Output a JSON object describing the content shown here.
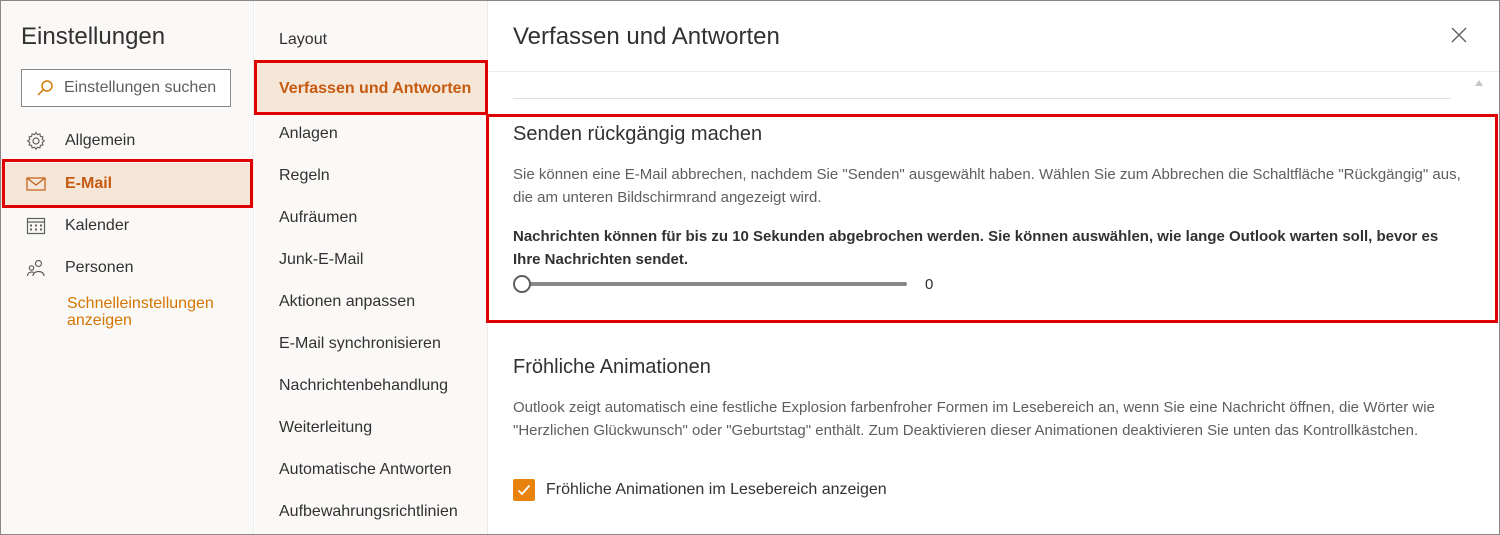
{
  "app": {
    "title": "Einstellungen"
  },
  "search": {
    "placeholder": "Einstellungen suchen",
    "icon": "search-icon"
  },
  "nav": {
    "items": [
      {
        "label": "Allgemein",
        "icon": "gear-icon",
        "active": false
      },
      {
        "label": "E-Mail",
        "icon": "mail-icon",
        "active": true
      },
      {
        "label": "Kalender",
        "icon": "calendar-icon",
        "active": false
      },
      {
        "label": "Personen",
        "icon": "people-icon",
        "active": false
      }
    ],
    "quick_link": "Schnelleinstellungen anzeigen"
  },
  "submenu": {
    "items": [
      {
        "label": "Layout"
      },
      {
        "label": "Verfassen und Antworten",
        "active": true
      },
      {
        "label": "Anlagen"
      },
      {
        "label": "Regeln"
      },
      {
        "label": "Aufräumen"
      },
      {
        "label": "Junk-E-Mail"
      },
      {
        "label": "Aktionen anpassen"
      },
      {
        "label": "E-Mail synchronisieren"
      },
      {
        "label": "Nachrichtenbehandlung"
      },
      {
        "label": "Weiterleitung"
      },
      {
        "label": "Automatische Antworten"
      },
      {
        "label": "Aufbewahrungsrichtlinien"
      }
    ]
  },
  "pane": {
    "title": "Verfassen und Antworten",
    "close_icon": "close-icon",
    "undo_send": {
      "title": "Senden rückgängig machen",
      "description": "Sie können eine E-Mail abbrechen, nachdem Sie \"Senden\" ausgewählt haben. Wählen Sie zum Abbrechen die Schaltfläche \"Rückgängig\" aus, die am unteren Bildschirmrand angezeigt wird.",
      "note": "Nachrichten können für bis zu 10 Sekunden abgebrochen werden. Sie können auswählen, wie lange Outlook warten soll, bevor es Ihre Nachrichten sendet.",
      "slider_value": "0",
      "slider_min": 0,
      "slider_max": 10
    },
    "animations": {
      "title": "Fröhliche Animationen",
      "description": "Outlook zeigt automatisch eine festliche Explosion farbenfroher Formen im Lesebereich an, wenn Sie eine Nachricht öffnen, die Wörter wie \"Herzlichen Glückwunsch\" oder \"Geburtstag\" enthält. Zum Deaktivieren dieser Animationen deaktivieren Sie unten das Kontrollkästchen.",
      "checkbox_label": "Fröhliche Animationen im Lesebereich anzeigen",
      "checked": true
    }
  },
  "colors": {
    "accent": "#c55a11",
    "selected_bg": "#f6e6d7",
    "link": "#d47500",
    "checkbox": "#e8820c",
    "highlight": "#e00000"
  }
}
